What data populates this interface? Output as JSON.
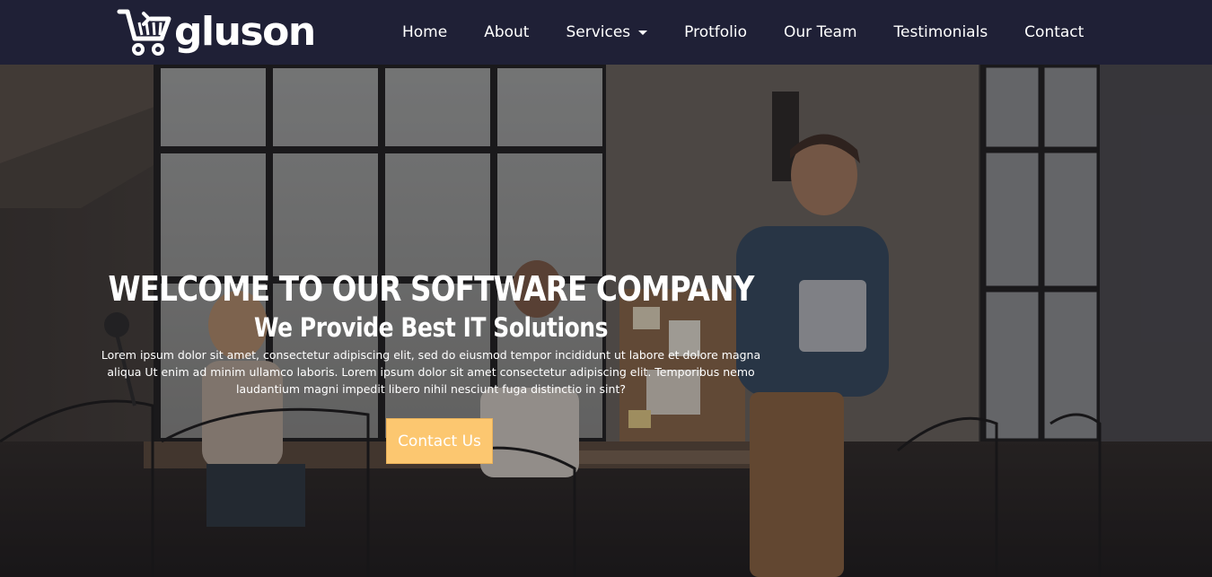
{
  "brand": {
    "name": "gluson"
  },
  "nav": {
    "items": [
      {
        "label": "Home"
      },
      {
        "label": "About"
      },
      {
        "label": "Services"
      },
      {
        "label": "Protfolio"
      },
      {
        "label": "Our Team"
      },
      {
        "label": "Testimonials"
      },
      {
        "label": "Contact"
      }
    ]
  },
  "hero": {
    "title": "WELCOME TO OUR SOFTWARE COMPANY",
    "subtitle": "We Provide Best IT Solutions",
    "text": "Lorem ipsum dolor sit amet, consectetur adipiscing elit, sed do eiusmod tempor incididunt ut labore et dolore magna aliqua Ut enim ad minim ullamco laboris. Lorem ipsum dolor sit amet consectetur adipiscing elit. Temporibus nemo laudantium magni impedit libero nihil nesciunt fuga distinctio in sint?",
    "button_label": "Contact Us"
  },
  "colors": {
    "navbar": "#1f2036",
    "button": "#fcc770",
    "text": "#ffffff"
  },
  "icons": {
    "logo": "shopping-cart-icon",
    "dropdown": "caret-down-icon"
  }
}
